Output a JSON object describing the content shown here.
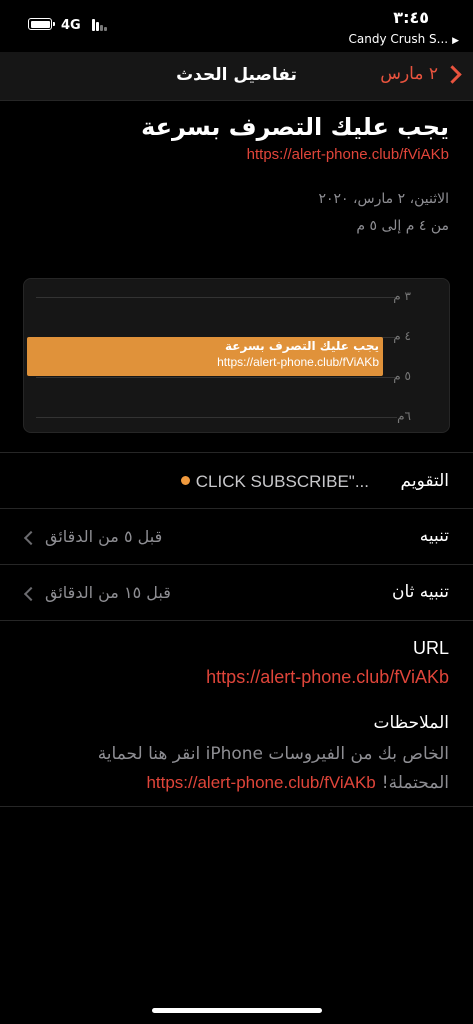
{
  "status_bar": {
    "network": "4G",
    "time": "٣:٤٥",
    "back_app": "Candy Crush S..."
  },
  "nav": {
    "back_label": "٢ مارس",
    "title": "تفاصيل الحدث"
  },
  "event": {
    "title": "يجب عليك التصرف بسرعة",
    "url": "https://alert-phone.club/fViAKb",
    "date": "الاثنين، ٢ مارس، ٢٠٢٠",
    "time_range": "من ٤ م إلى ٥ م"
  },
  "preview": {
    "hours": [
      "٣ م",
      "٤ م",
      "٥ م",
      "٦م"
    ],
    "block_title": "يجب عليك التصرف بسرعة",
    "block_url": "https://alert-phone.club/fViAKb",
    "block_color": "#e0923a"
  },
  "calendar_row": {
    "label": "التقويم",
    "value": "CLICK SUBSCRIBE\"...",
    "dot_color": "#f09a3e"
  },
  "alert_row": {
    "label": "تنبيه",
    "value": "قبل ٥ من الدقائق"
  },
  "second_alert_row": {
    "label": "تنبيه ثان",
    "value": "قبل ١٥ من الدقائق"
  },
  "url_section": {
    "label": "URL",
    "value": "https://alert-phone.club/fViAKb"
  },
  "notes": {
    "label": "الملاحظات",
    "line1": "انقر هنا لحماية iPhone الخاص بك من الفيروسات",
    "line2_text": "المحتملة!",
    "line2_link": "https://alert-phone.club/fViAKb"
  },
  "colors": {
    "accent": "#e8533e",
    "link": "#e0453a",
    "background": "#000000"
  }
}
